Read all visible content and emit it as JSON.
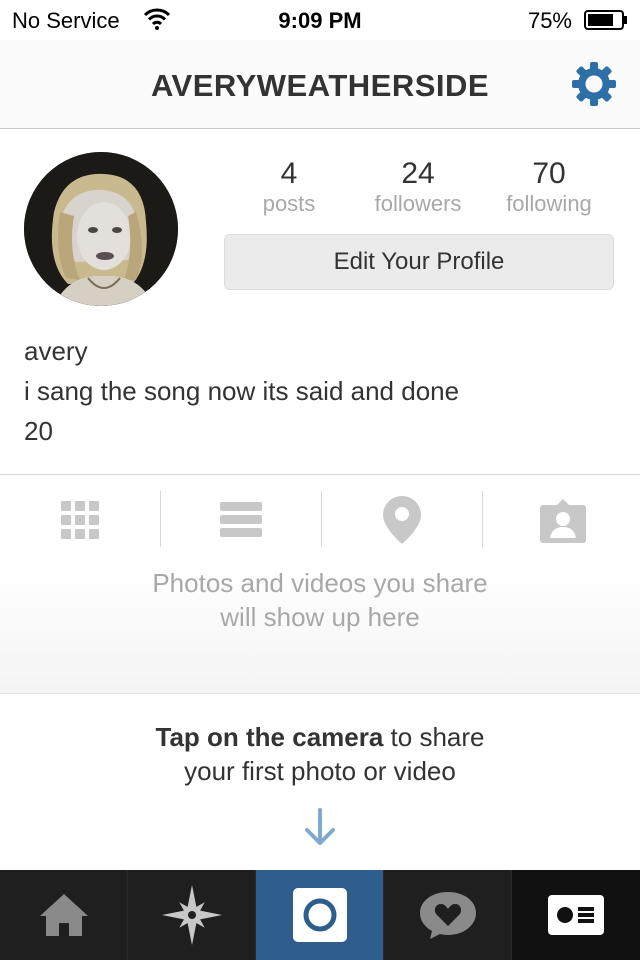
{
  "status_bar": {
    "carrier": "No Service",
    "time": "9:09 PM",
    "battery": "75%"
  },
  "header": {
    "title": "AVERYWEATHERSIDE"
  },
  "profile": {
    "stats": [
      {
        "value": "4",
        "label": "posts"
      },
      {
        "value": "24",
        "label": "followers"
      },
      {
        "value": "70",
        "label": "following"
      }
    ],
    "edit_button": "Edit Your Profile",
    "name": "avery",
    "bio_line1": "i sang the song now its said and done",
    "bio_line2": "20"
  },
  "view_tabs": [
    "grid-icon",
    "list-icon",
    "map-pin-icon",
    "tagged-photos-icon"
  ],
  "empty_state": {
    "line1": "Photos and videos you share",
    "line2": "will show up here",
    "tip_bold": "Tap on the camera",
    "tip_rest": " to share",
    "tip_line2": "your first photo or video"
  },
  "tab_bar": {
    "items": [
      "home-icon",
      "explore-icon",
      "camera-icon",
      "activity-icon",
      "profile-icon"
    ],
    "active": "camera-icon",
    "active_color": "#2e5e8e",
    "bar_color": "#1c1c1c"
  },
  "colors": {
    "accent": "#2e6fa8",
    "muted_text": "#a8a8a8",
    "text": "#333333"
  }
}
